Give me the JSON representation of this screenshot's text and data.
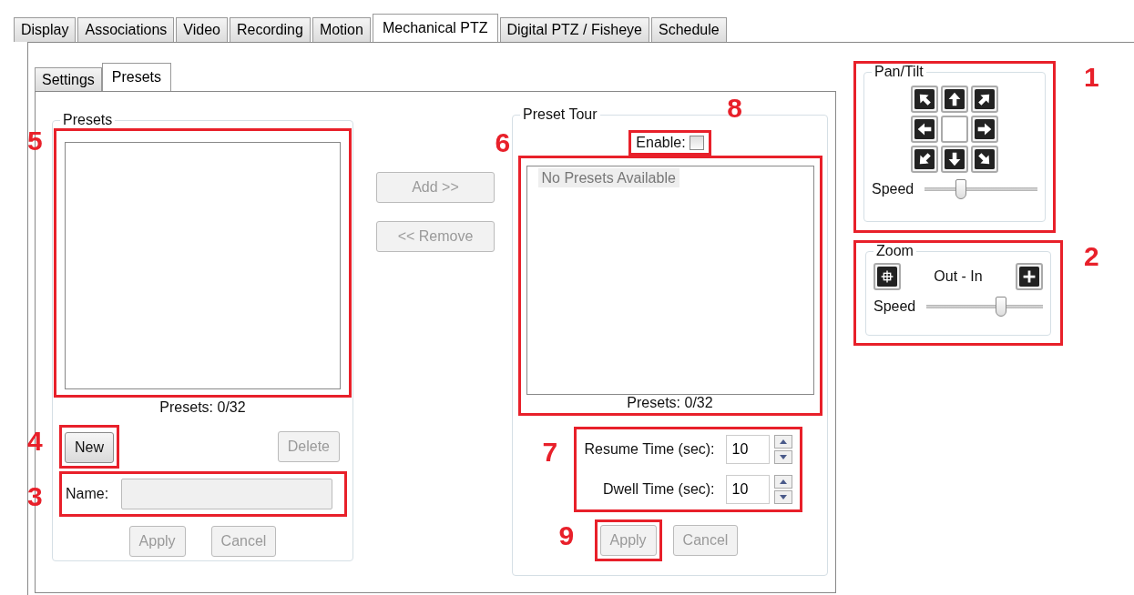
{
  "main_tabs": [
    {
      "label": "Display",
      "selected": false
    },
    {
      "label": "Associations",
      "selected": false
    },
    {
      "label": "Video",
      "selected": false
    },
    {
      "label": "Recording",
      "selected": false
    },
    {
      "label": "Motion",
      "selected": false
    },
    {
      "label": "Mechanical PTZ",
      "selected": true
    },
    {
      "label": "Digital PTZ / Fisheye",
      "selected": false
    },
    {
      "label": "Schedule",
      "selected": false
    }
  ],
  "sub_tabs": [
    {
      "label": "Settings",
      "selected": false
    },
    {
      "label": "Presets",
      "selected": true
    }
  ],
  "presets": {
    "title": "Presets",
    "list_callout": "5",
    "count": "Presets: 0/32",
    "new_button": {
      "label": "New",
      "disabled": false,
      "callout": "4"
    },
    "delete_button": {
      "label": "Delete",
      "disabled": true
    },
    "name_field": {
      "label": "Name:",
      "disabled": true,
      "callout": "3"
    },
    "actions": [
      {
        "label": "Apply",
        "disabled": true
      },
      {
        "label": "Cancel",
        "disabled": true
      }
    ]
  },
  "transfer_buttons": [
    {
      "label": "Add >>",
      "disabled": true
    },
    {
      "label": "<< Remove",
      "disabled": true
    }
  ],
  "tour": {
    "title": "Preset Tour",
    "enable": {
      "label": "Enable:",
      "checked": false,
      "callout": "8"
    },
    "list_callout": "6",
    "empty_text": "No Presets Available",
    "count": "Presets: 0/32",
    "times_callout": "7",
    "times": [
      {
        "label": "Resume Time (sec):",
        "value": "10"
      },
      {
        "label": "Dwell Time (sec):",
        "value": "10"
      }
    ],
    "apply_button": {
      "label": "Apply",
      "disabled": true,
      "callout": "9"
    },
    "cancel_button": {
      "label": "Cancel",
      "disabled": true
    }
  },
  "pan_tilt": {
    "title": "Pan/Tilt",
    "callout": "1",
    "speed_label": "Speed",
    "level": 0.32
  },
  "zoom": {
    "title": "Zoom",
    "callout": "2",
    "range_label": "Out - In",
    "speed_label": "Speed",
    "level": 0.64
  }
}
